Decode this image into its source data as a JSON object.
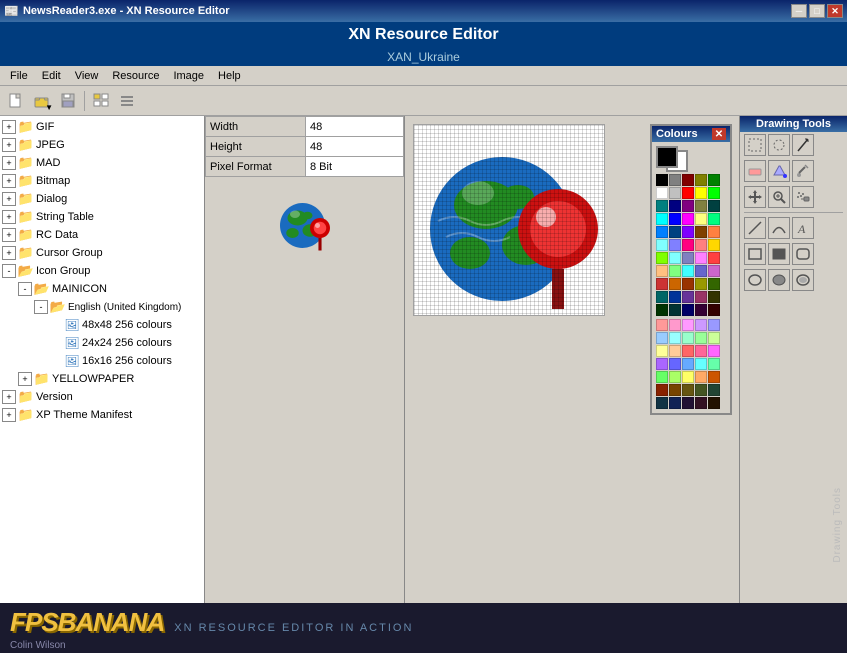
{
  "window": {
    "title": "NewsReader3.exe - XN Resource Editor",
    "app_title": "XN Resource Editor",
    "app_subtitle": "XAN_Ukraine"
  },
  "title_buttons": {
    "minimize": "─",
    "restore": "□",
    "close": "✕"
  },
  "menu": {
    "items": [
      "File",
      "Edit",
      "View",
      "Resource",
      "Image",
      "Help"
    ]
  },
  "properties": {
    "width_label": "Width",
    "width_value": "48",
    "height_label": "Height",
    "height_value": "48",
    "pixel_format_label": "Pixel Format",
    "pixel_format_value": "8 Bit"
  },
  "tree": {
    "items": [
      {
        "label": "GIF",
        "type": "folder",
        "indent": 0,
        "expanded": false
      },
      {
        "label": "JPEG",
        "type": "folder",
        "indent": 0,
        "expanded": false
      },
      {
        "label": "MAD",
        "type": "folder",
        "indent": 0,
        "expanded": false
      },
      {
        "label": "Bitmap",
        "type": "folder",
        "indent": 0,
        "expanded": false
      },
      {
        "label": "Dialog",
        "type": "folder",
        "indent": 0,
        "expanded": false
      },
      {
        "label": "String Table",
        "type": "folder",
        "indent": 0,
        "expanded": false
      },
      {
        "label": "RC Data",
        "type": "folder",
        "indent": 0,
        "expanded": false
      },
      {
        "label": "Cursor Group",
        "type": "folder",
        "indent": 0,
        "expanded": false
      },
      {
        "label": "Icon Group",
        "type": "folder",
        "indent": 0,
        "expanded": true
      },
      {
        "label": "MAINICON",
        "type": "folder",
        "indent": 1,
        "expanded": true
      },
      {
        "label": "English (United Kingdom)",
        "type": "folder",
        "indent": 2,
        "expanded": true
      },
      {
        "label": "48x48 256 colours",
        "type": "file",
        "indent": 3,
        "expanded": false,
        "selected": false
      },
      {
        "label": "24x24 256 colours",
        "type": "file",
        "indent": 3,
        "expanded": false,
        "selected": false
      },
      {
        "label": "16x16 256 colours",
        "type": "file",
        "indent": 3,
        "expanded": false,
        "selected": false
      },
      {
        "label": "YELLOWPAPER",
        "type": "folder",
        "indent": 1,
        "expanded": false
      },
      {
        "label": "Version",
        "type": "folder",
        "indent": 0,
        "expanded": false
      },
      {
        "label": "XP Theme Manifest",
        "type": "folder",
        "indent": 0,
        "expanded": false
      }
    ]
  },
  "drawing_tools": {
    "title": "Drawing Tools",
    "tools": [
      {
        "name": "rect-select",
        "icon": "⬚"
      },
      {
        "name": "lasso-select",
        "icon": "⊙"
      },
      {
        "name": "pencil",
        "icon": "✏"
      },
      {
        "name": "eraser",
        "icon": "◻"
      },
      {
        "name": "fill",
        "icon": "⬛"
      },
      {
        "name": "eyedropper",
        "icon": "⊘"
      },
      {
        "name": "move",
        "icon": "✥"
      },
      {
        "name": "zoom",
        "icon": "⊕"
      },
      {
        "name": "line",
        "icon": "/"
      },
      {
        "name": "airbrush",
        "icon": "∴"
      },
      {
        "name": "text",
        "icon": "A"
      },
      {
        "name": "rect",
        "icon": "□"
      },
      {
        "name": "filled-rect",
        "icon": "■"
      },
      {
        "name": "circle",
        "icon": "○"
      },
      {
        "name": "filled-circle",
        "icon": "●"
      }
    ]
  },
  "colours": {
    "title": "Colours",
    "rows": [
      [
        "#000000",
        "#808080",
        "#800000",
        "#808000",
        "#008000",
        "#008080",
        "#000080",
        "#800080",
        "#808040",
        "#004040",
        "#0080FF",
        "#004080",
        "#8000FF",
        "#804000"
      ],
      [
        "#FFFFFF",
        "#C0C0C0",
        "#FF0000",
        "#FFFF00",
        "#00FF00",
        "#00FFFF",
        "#0000FF",
        "#FF00FF",
        "#FFFF80",
        "#00FF80",
        "#80FFFF",
        "#8080FF",
        "#FF0080",
        "#FF8040"
      ],
      [
        "#FF8080",
        "#FFD700",
        "#80FF00",
        "#80FFFF",
        "#8080C0",
        "#FF80FF",
        "#FF4040",
        "#FFC080",
        "#80FF80",
        "#40FFFF",
        "#6666CC",
        "#CC66CC",
        "#CC3333",
        "#CC6600"
      ],
      [
        "#993300",
        "#999900",
        "#336600",
        "#006666",
        "#003399",
        "#663399",
        "#993366",
        "#333300",
        "#003300",
        "#003333",
        "#000066",
        "#330033",
        "#330000",
        "#000000"
      ]
    ]
  },
  "footer": {
    "logo": "FPSBANANA",
    "tagline": "XN RESOURCE EDITOR IN ACTION",
    "author": "Colin Wilson"
  },
  "scrollbar": {
    "left_arrow": "◄",
    "right_arrow": "►"
  }
}
